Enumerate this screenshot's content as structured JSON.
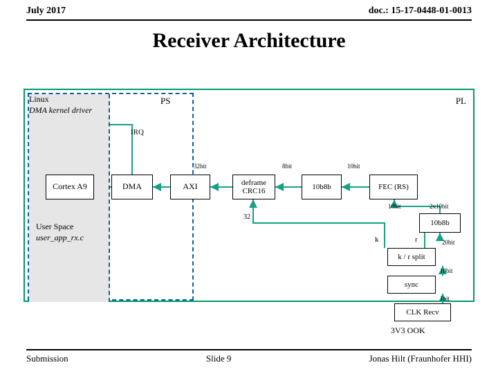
{
  "header": {
    "date": "July 2017",
    "doc": "doc.: 15-17-0448-01-0013"
  },
  "title": "Receiver Architecture",
  "labels": {
    "ps": "PS",
    "pl": "PL",
    "irq": "IRQ",
    "linux1": "Linux",
    "linux2": "DMA kernel driver",
    "user1": "User Space",
    "user2": "user_app_rx.c",
    "ook": "3V3 OOK"
  },
  "blocks": {
    "cortex": "Cortex A9",
    "dma": "DMA",
    "axi": "AXI",
    "deframe": "deframe CRC16",
    "b10b8_1": "10b8b",
    "fec": "FEC (RS)",
    "b10b8_2": "10b8b",
    "krsplit": "k / r split",
    "sync": "sync",
    "clk": "CLK Recv"
  },
  "widths": {
    "w32bit": "32bit",
    "w8bit": "8bit",
    "w10bit": "10bit",
    "w2x10": "2x10bit",
    "w20bit": "20bit",
    "w1bit": "1bit",
    "w32": "32",
    "k": "k",
    "r": "r"
  },
  "footer": {
    "left": "Submission",
    "center": "Slide 9",
    "right": "Jonas Hilt (Fraunhofer HHI)"
  }
}
